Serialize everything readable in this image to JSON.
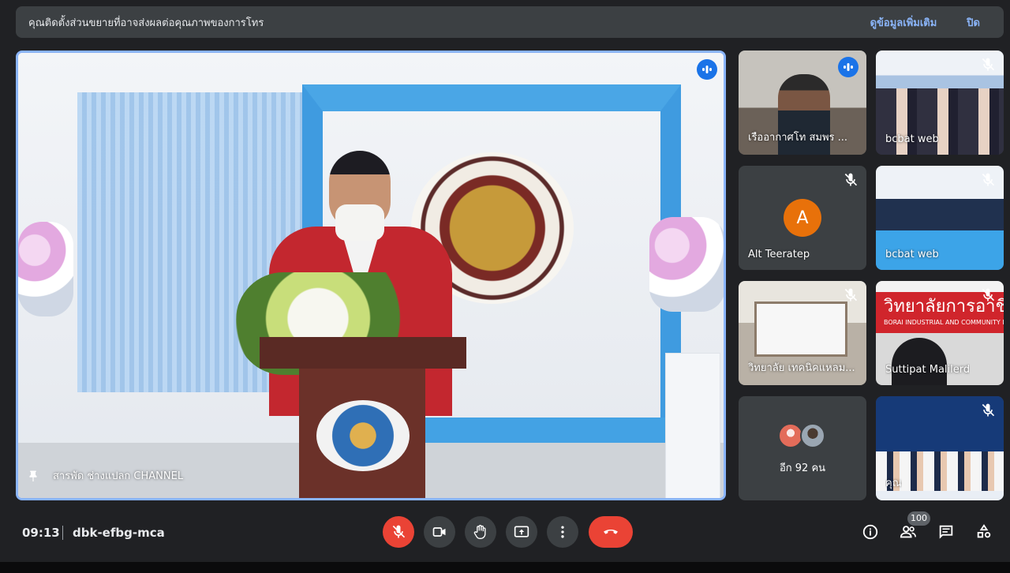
{
  "banner": {
    "message": "คุณติดตั้งส่วนขยายที่อาจส่งผลต่อคุณภาพของการโทร",
    "more_info": "ดูข้อมูลเพิ่มเติม",
    "dismiss": "ปิด"
  },
  "stage": {
    "presenter_name": "สารพัด ช่างแปลก CHANNEL",
    "speaking": true
  },
  "tiles": [
    {
      "name": "เรืออากาศโท สมพร ...",
      "state": "speaking"
    },
    {
      "name": "bcbat web",
      "state": "muted"
    },
    {
      "name": "Alt Teeratep",
      "state": "muted",
      "initial": "A"
    },
    {
      "name": "bcbat web",
      "state": "muted"
    },
    {
      "name": "วิทยาลัย เทคนิคแหลม...",
      "state": "muted"
    },
    {
      "name": "Suttipat Malilerd",
      "state": "muted",
      "banner_text": "วิทยาลัยการอาชีพ",
      "banner_sub": "BORAI INDUSTRIAL AND COMMUNITY EDUC"
    },
    {
      "name": "อีก 92 คน",
      "state": "overflow"
    },
    {
      "name": "คุณ",
      "state": "muted"
    }
  ],
  "meeting": {
    "time": "09:13",
    "code": "dbk-efbg-mca",
    "participants_count": "100"
  },
  "colors": {
    "background": "#202124",
    "surface": "#3c4043",
    "accent": "#8ab4f8",
    "active_speaker": "#1a73e8",
    "danger": "#ea4335",
    "avatar_orange": "#e8710a"
  },
  "icons": {
    "mic_off": "mic-off-icon",
    "camera": "camera-icon",
    "raise_hand": "hand-icon",
    "present": "present-screen-icon",
    "more": "more-vert-icon",
    "leave": "call-end-icon",
    "info": "info-icon",
    "people": "people-icon",
    "chat": "chat-icon",
    "activities": "activities-icon",
    "pin": "pin-icon"
  }
}
